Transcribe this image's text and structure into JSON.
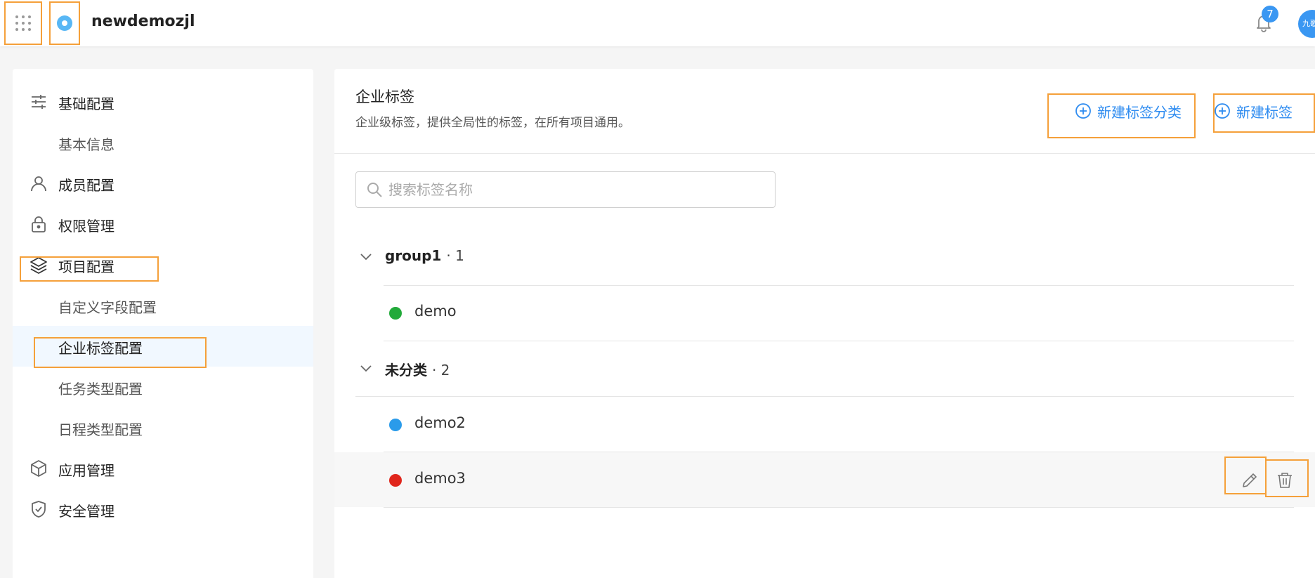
{
  "topbar": {
    "org_name": "newdemozjl",
    "notification_count": "7",
    "avatar_text": "九歌"
  },
  "sidebar": {
    "items": [
      {
        "label": "基础配置",
        "icon": "sliders-icon"
      },
      {
        "label": "基本信息",
        "icon": ""
      },
      {
        "label": "成员配置",
        "icon": "user-icon"
      },
      {
        "label": "权限管理",
        "icon": "lock-icon"
      },
      {
        "label": "项目配置",
        "icon": "layers-icon"
      },
      {
        "label": "自定义字段配置",
        "icon": ""
      },
      {
        "label": "企业标签配置",
        "icon": "",
        "active": true
      },
      {
        "label": "任务类型配置",
        "icon": ""
      },
      {
        "label": "日程类型配置",
        "icon": ""
      },
      {
        "label": "应用管理",
        "icon": "cube-icon"
      },
      {
        "label": "安全管理",
        "icon": "shield-check-icon"
      }
    ]
  },
  "main": {
    "title": "企业标签",
    "description": "企业级标签，提供全局性的标签，在所有项目通用。",
    "new_category_label": "新建标签分类",
    "new_tag_label": "新建标签",
    "search_placeholder": "搜索标签名称",
    "groups": [
      {
        "name": "group1",
        "count": "· 1",
        "tags": [
          {
            "name": "demo",
            "color": "#22aa3a"
          }
        ]
      },
      {
        "name": "未分类",
        "count": "· 2",
        "tags": [
          {
            "name": "demo2",
            "color": "#2a9bea"
          },
          {
            "name": "demo3",
            "color": "#e0261c"
          }
        ]
      }
    ]
  },
  "colors": {
    "accent": "#2f8cf0",
    "highlight_box": "#f5a03a",
    "active_bg": "#f1f8ff"
  }
}
